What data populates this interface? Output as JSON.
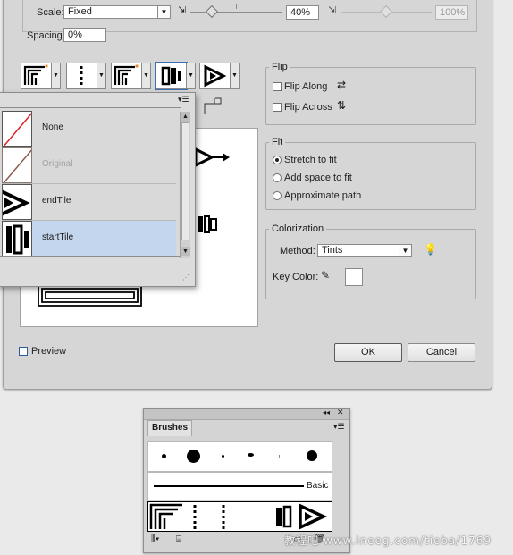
{
  "dialog": {
    "scale": {
      "label": "Scale:",
      "value": "Fixed",
      "percent": "40%",
      "percent_max": "100%"
    },
    "spacing": {
      "label": "Spacing:",
      "value": "0%"
    },
    "tiles": [
      {
        "name": "side-tile"
      },
      {
        "name": "outer-corner-tile"
      },
      {
        "name": "inner-corner-tile"
      },
      {
        "name": "start-tile"
      },
      {
        "name": "end-tile"
      }
    ],
    "tile_menu": {
      "items": [
        {
          "label": "None"
        },
        {
          "label": "Original"
        },
        {
          "label": "endTile"
        },
        {
          "label": "startTile"
        }
      ],
      "selected": "startTile"
    },
    "flip": {
      "title": "Flip",
      "along": "Flip Along",
      "across": "Flip Across"
    },
    "fit": {
      "title": "Fit",
      "options": [
        "Stretch to fit",
        "Add space to fit",
        "Approximate path"
      ],
      "selected": "Stretch to fit"
    },
    "colorization": {
      "title": "Colorization",
      "method_label": "Method:",
      "method_value": "Tints",
      "key_color_label": "Key Color:"
    },
    "preview_label": "Preview",
    "ok_label": "OK",
    "cancel_label": "Cancel"
  },
  "brushes_panel": {
    "title": "Brushes",
    "basic_label": "Basic"
  },
  "watermark": "教程吧 www.ineeg.com/tieba/1769"
}
